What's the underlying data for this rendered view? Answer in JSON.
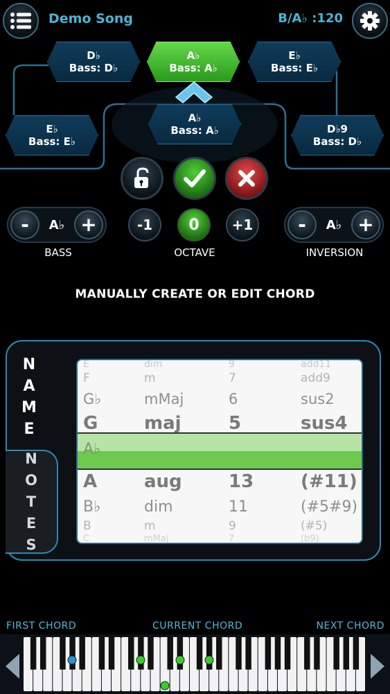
{
  "header": {
    "menu_icon": "list-menu-icon",
    "song_title": "Demo Song",
    "key_tempo": "B/A♭ :120",
    "settings_icon": "gear-icon"
  },
  "chord_tree": {
    "top_row": [
      {
        "chord": "D♭",
        "bass": "Bass: D♭"
      },
      {
        "chord": "A♭",
        "bass": "Bass: A♭",
        "active": true
      },
      {
        "chord": "E♭",
        "bass": "Bass: E♭"
      }
    ],
    "second_row": [
      {
        "chord": "E♭",
        "bass": "Bass: E♭"
      },
      {
        "chord": "A♭",
        "bass": "Bass: A♭"
      },
      {
        "chord": "D♭9",
        "bass": "Bass: D♭"
      }
    ]
  },
  "actions": {
    "lock_icon": "unlock-icon",
    "confirm_icon": "checkmark-icon",
    "cancel_icon": "x-icon"
  },
  "bass": {
    "minus": "-",
    "value": "A♭",
    "plus": "+",
    "label": "BASS"
  },
  "octave": {
    "minus": "-1",
    "value": "0",
    "plus": "+1",
    "label": "OCTAVE"
  },
  "inversion": {
    "minus": "-",
    "value": "A♭",
    "plus": "+",
    "label": "INVERSION"
  },
  "instruction": "MANUALLY CREATE OR EDIT CHORD",
  "tabs": {
    "name": [
      "N",
      "A",
      "M",
      "E"
    ],
    "notes": [
      "N",
      "O",
      "T",
      "E",
      "S"
    ]
  },
  "picker": {
    "rows": [
      {
        "root": "E",
        "quality": "dim",
        "ext": "9",
        "add": "add11"
      },
      {
        "root": "F",
        "quality": "m",
        "ext": "7",
        "add": "add9"
      },
      {
        "root": "G♭",
        "quality": "mMaj",
        "ext": "6",
        "add": "sus2"
      },
      {
        "root": "G",
        "quality": "maj",
        "ext": "5",
        "add": "sus4"
      },
      {
        "root": "A",
        "quality": "aug",
        "ext": "13",
        "add": "(#11)"
      },
      {
        "root": "B♭",
        "quality": "dim",
        "ext": "11",
        "add": "(#5#9)"
      },
      {
        "root": "B",
        "quality": "m",
        "ext": "9",
        "add": "(#5)"
      },
      {
        "root": "C",
        "quality": "mMaj",
        "ext": "7",
        "add": "(b9)"
      }
    ],
    "selected": "A♭"
  },
  "keyboard": {
    "first_label": "FIRST  CHORD",
    "current_label": "CURRENT  CHORD",
    "next_label": "NEXT  CHORD"
  }
}
